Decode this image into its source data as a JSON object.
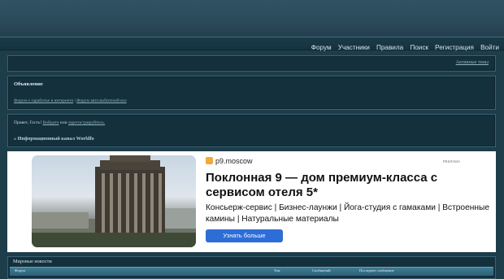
{
  "nav": [
    "Форум",
    "Участники",
    "Правила",
    "Поиск",
    "Регистрация",
    "Войти"
  ],
  "topbar": {
    "active_topics": "Активные темы"
  },
  "announcement": {
    "title": "Объявление",
    "links": [
      "Форум о заработке в интернете",
      "Форум автолюбителей все"
    ]
  },
  "welcome": {
    "greeting": "Привет, Гость!",
    "login": "Войдите",
    "or": "или",
    "register": "зарегистрируйтесь."
  },
  "breadcrumb": "» Информационный канал Worldfo",
  "ad": {
    "brand": "p9.moscow",
    "tag": "РЕКЛАМА",
    "headline": "Поклонная 9 — дом премиум-класса с сервисом отеля 5*",
    "description": "Консьерж-сервис | Бизнес-лаунжи | Йога-студия с гамаками | Встроенные камины | Натуральные материалы",
    "button": "Узнать больше"
  },
  "section": {
    "title": "Мировые новости",
    "columns": [
      "Форум",
      "Тем",
      "Сообщений",
      "Последнее сообщение"
    ]
  },
  "colors": {
    "background": "#1d3d4b",
    "panel": "#14303c",
    "accent": "#3e7d95",
    "ad_button": "#2d6dd6"
  }
}
